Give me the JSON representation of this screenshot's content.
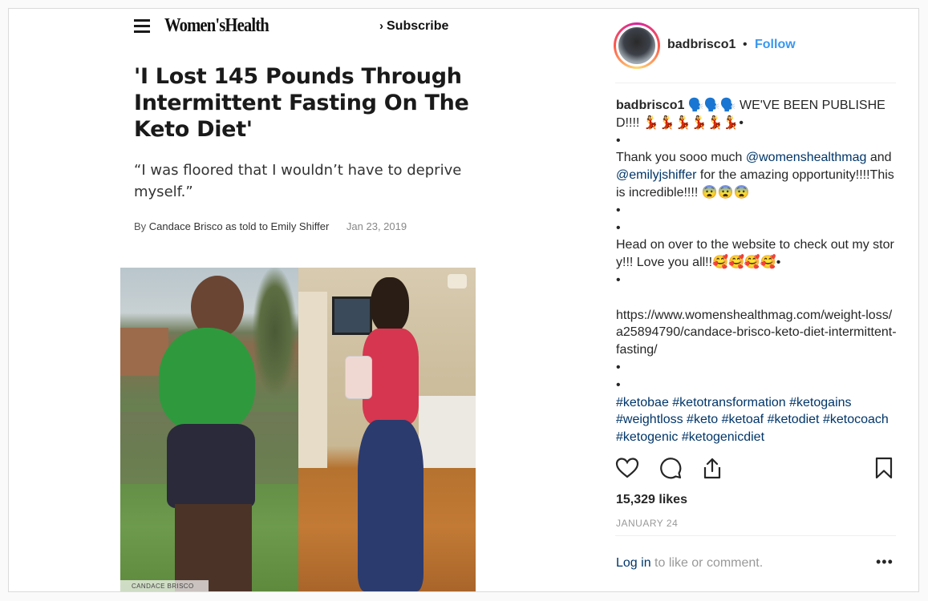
{
  "article": {
    "brand": "Women'sHealth",
    "subscribe_chevron": "›",
    "subscribe_label": "Subscribe",
    "headline": "'I Lost 145 Pounds Through Intermittent Fasting On The Keto Diet'",
    "dek": "“I was floored that I wouldn’t have to deprive myself.”",
    "byline_prefix": "By",
    "byline_names": "Candace Brisco as told to Emily Shiffer",
    "date": "Jan 23, 2019",
    "photo_credit": "CANDACE BRISCO"
  },
  "post": {
    "username": "badbrisco1",
    "separator": "•",
    "follow_label": "Follow",
    "caption": {
      "line1_text": " 🗣️🗣️🗣️ WE'VE BEEN PUBLISHED!!!! 💃💃💃💃💃💃•",
      "bullet": "•",
      "thanks_prefix": "Thank you sooo much ",
      "mention1": "@womenshealthmag",
      "and_text": " and ",
      "mention2": "@emilyjshiffer",
      "thanks_suffix": " for the amazing opportunity!!!!This is incredible!!!! 😨😨😨",
      "head_on": "Head on over to the website to check out my story!!! Love you all!!🥰🥰🥰🥰•",
      "url": "https://www.womenshealthmag.com/weight-loss/a25894790/candace-brisco-keto-diet-intermittent-fasting/",
      "hashtags": "#ketobae #ketotransformation #ketogains #weightloss #keto #ketoaf #ketodiet #ketocoach #ketogenic #ketogenicdiet"
    },
    "likes": "15,329 likes",
    "date": "JANUARY 24",
    "login_link": "Log in",
    "login_suffix": " to like or comment.",
    "more_label": "•••"
  },
  "colors": {
    "link_blue": "#3897f0",
    "mention_navy": "#003569",
    "muted": "#999999",
    "border": "#dbdbdb"
  },
  "icons": [
    "hamburger-icon",
    "heart-icon",
    "comment-icon",
    "share-icon",
    "bookmark-icon",
    "more-icon"
  ]
}
